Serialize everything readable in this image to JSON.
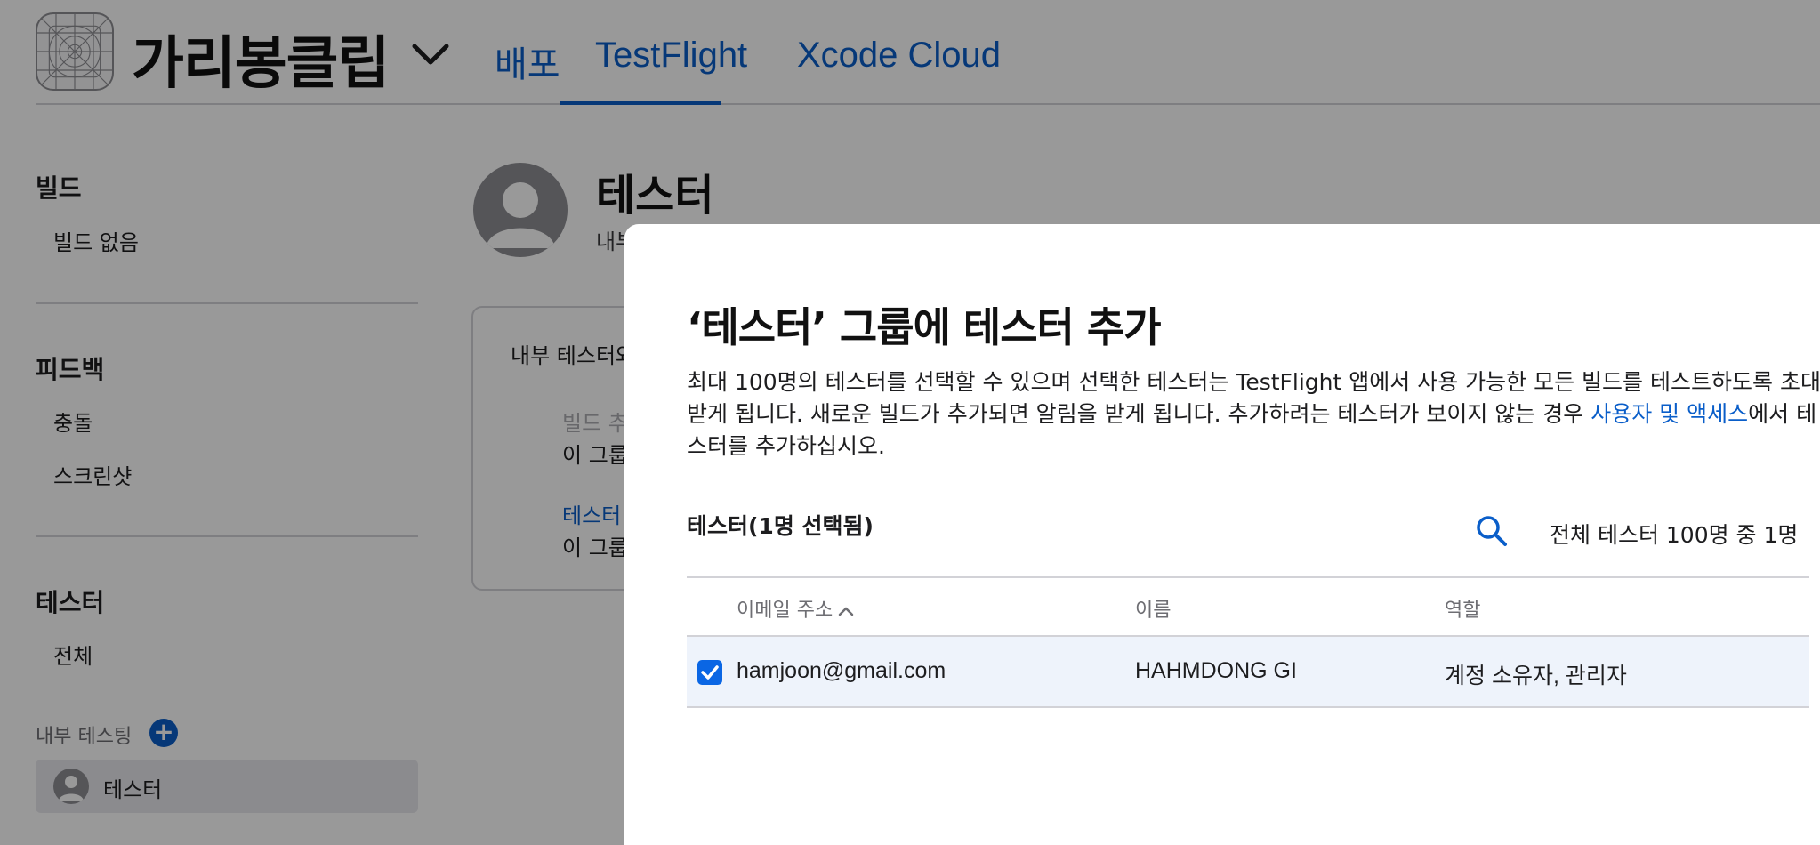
{
  "header": {
    "app_name": "가리봉클립",
    "tabs": [
      {
        "label": "배포"
      },
      {
        "label": "TestFlight"
      },
      {
        "label": "Xcode Cloud"
      }
    ],
    "active_tab": "TestFlight"
  },
  "sidebar": {
    "builds": {
      "title": "빌드",
      "items": [
        "빌드 없음"
      ]
    },
    "feedback": {
      "title": "피드백",
      "items": [
        "충돌",
        "스크린샷"
      ]
    },
    "testers": {
      "title": "테스터",
      "items": [
        "전체"
      ]
    },
    "internal_testing": {
      "label": "내부 테스팅",
      "selected_group": "테스터"
    }
  },
  "main": {
    "title": "테스터",
    "subtitle": "내부",
    "card": {
      "title": "내부 테스터와",
      "line1": "빌드 추",
      "line2": "이 그룹",
      "line3": "테스터",
      "line4": "이 그룹"
    }
  },
  "modal": {
    "title": "‘테스터’ 그룹에 테스터 추가",
    "description_before": "최대 100명의 테스터를 선택할 수 있으며 선택한 테스터는 TestFlight 앱에서 사용 가능한 모든 빌드를 테스트하도록 초대받게 됩니다. 새로운 빌드가 추가되면 알림을 받게 됩니다. 추가하려는 테스터가 보이지 않는 경우 ",
    "description_link": "사용자 및 액세스",
    "description_after": "에서 테스터를 추가하십시오.",
    "tester_count": "테스터(1명 선택됨)",
    "total_count": "전체 테스터 100명 중 1명",
    "table": {
      "headers": {
        "email": "이메일 주소",
        "name": "이름",
        "role": "역할"
      },
      "sort": "ascending",
      "rows": [
        {
          "email": "hamjoon@gmail.com",
          "name": "HAHMDONG GI",
          "role": "계정 소유자, 관리자",
          "checked": true
        }
      ]
    }
  },
  "colors": {
    "accent": "#0a5ec9",
    "overlay": "rgba(0,0,0,0.4)",
    "row_selected": "#eef3fb"
  }
}
